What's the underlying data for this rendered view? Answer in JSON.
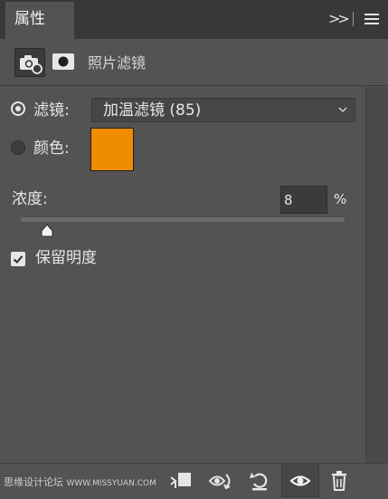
{
  "header": {
    "tab_label": "属性",
    "collapse_glyph": ">>"
  },
  "subheader": {
    "title": "照片滤镜"
  },
  "filter": {
    "label": "滤镜:",
    "selected": "加温滤镜 (85)"
  },
  "color": {
    "label": "颜色:",
    "swatch": "#f08c00"
  },
  "density": {
    "label": "浓度:",
    "value": "8",
    "unit": "%",
    "fraction": 0.08
  },
  "preserve_luminosity": {
    "label": "保留明度",
    "checked": true
  },
  "watermark": {
    "text": "思缘设计论坛",
    "url": "WWW.MISSYUAN.COM"
  },
  "icons": {
    "camera": "camera-icon",
    "mask": "mask-icon",
    "clip": "clip-to-layer-icon",
    "view_previous": "view-previous-state-icon",
    "reset": "reset-icon",
    "visibility": "eye-icon",
    "delete": "trash-icon"
  },
  "colors": {
    "panel": "#535353",
    "header": "#383838",
    "accent_swatch": "#f08c00"
  }
}
